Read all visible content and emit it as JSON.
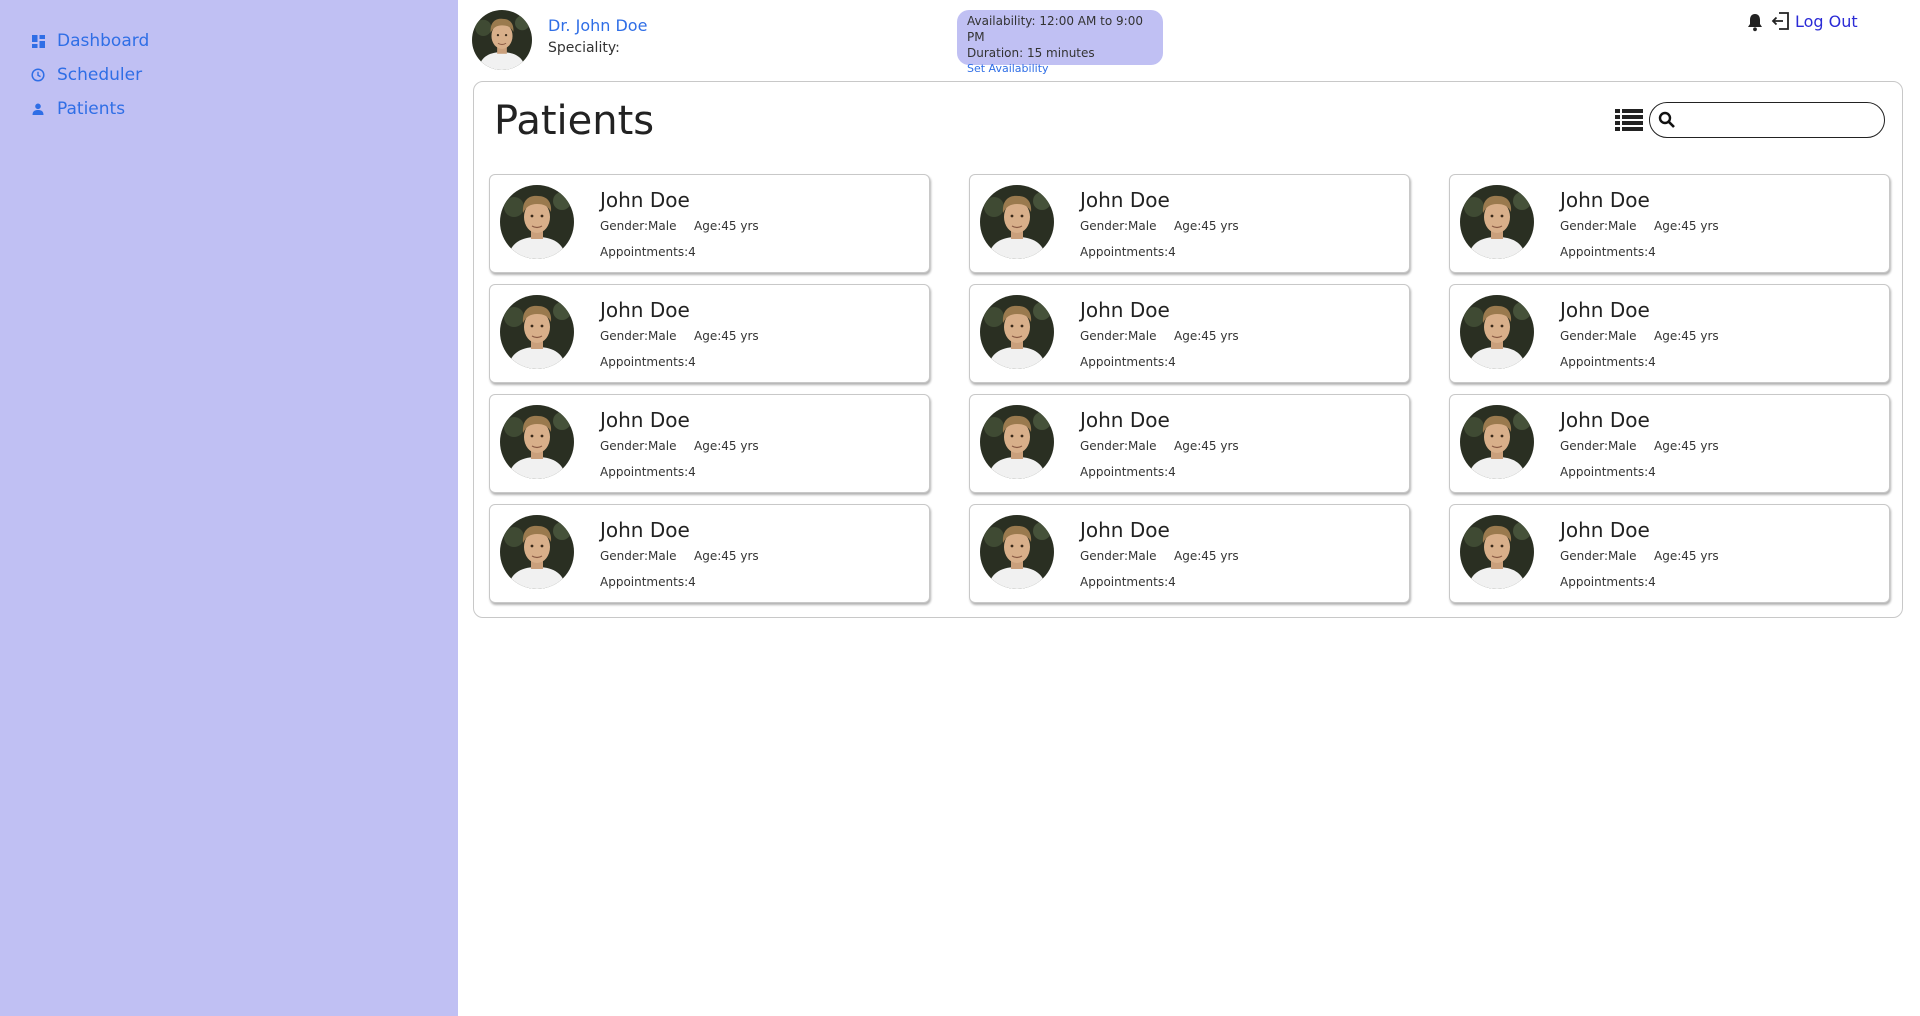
{
  "sidebar": {
    "items": [
      {
        "label": "Dashboard",
        "icon": "dashboard-icon"
      },
      {
        "label": "Scheduler",
        "icon": "clock-icon"
      },
      {
        "label": "Patients",
        "icon": "person-icon"
      }
    ]
  },
  "header": {
    "doctor_name": "Dr. John Doe",
    "speciality_label": "Speciality:",
    "availability": "Availability: 12:00 AM to 9:00 PM",
    "duration": "Duration: 15 minutes",
    "set_availability": "Set Availability",
    "logout_label": "Log Out"
  },
  "main": {
    "title": "Patients",
    "search_placeholder": ""
  },
  "patients": [
    {
      "name": "John Doe",
      "gender": "Gender:Male",
      "age": "Age:45 yrs",
      "appointments": "Appointments:4"
    },
    {
      "name": "John Doe",
      "gender": "Gender:Male",
      "age": "Age:45 yrs",
      "appointments": "Appointments:4"
    },
    {
      "name": "John Doe",
      "gender": "Gender:Male",
      "age": "Age:45 yrs",
      "appointments": "Appointments:4"
    },
    {
      "name": "John Doe",
      "gender": "Gender:Male",
      "age": "Age:45 yrs",
      "appointments": "Appointments:4"
    },
    {
      "name": "John Doe",
      "gender": "Gender:Male",
      "age": "Age:45 yrs",
      "appointments": "Appointments:4"
    },
    {
      "name": "John Doe",
      "gender": "Gender:Male",
      "age": "Age:45 yrs",
      "appointments": "Appointments:4"
    },
    {
      "name": "John Doe",
      "gender": "Gender:Male",
      "age": "Age:45 yrs",
      "appointments": "Appointments:4"
    },
    {
      "name": "John Doe",
      "gender": "Gender:Male",
      "age": "Age:45 yrs",
      "appointments": "Appointments:4"
    },
    {
      "name": "John Doe",
      "gender": "Gender:Male",
      "age": "Age:45 yrs",
      "appointments": "Appointments:4"
    },
    {
      "name": "John Doe",
      "gender": "Gender:Male",
      "age": "Age:45 yrs",
      "appointments": "Appointments:4"
    },
    {
      "name": "John Doe",
      "gender": "Gender:Male",
      "age": "Age:45 yrs",
      "appointments": "Appointments:4"
    },
    {
      "name": "John Doe",
      "gender": "Gender:Male",
      "age": "Age:45 yrs",
      "appointments": "Appointments:4"
    }
  ],
  "colors": {
    "sidebar_bg": "#c0c0f3",
    "link_blue": "#2f6ee6",
    "logout_blue": "#2b2bd6"
  }
}
